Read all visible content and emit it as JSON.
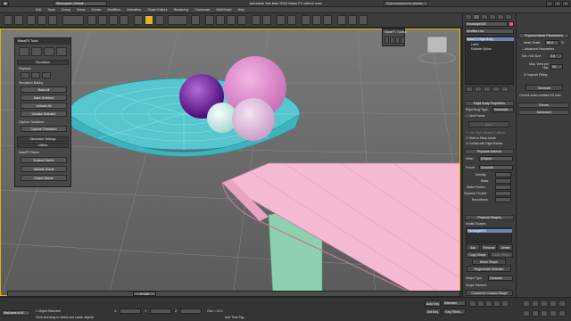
{
  "app": {
    "title": "Autodesk 3ds Max 2015   Mass FX video2.max",
    "workspace": "Workspace: Default",
    "search_placeholder": "Type a keyword or phrase"
  },
  "menu": [
    "Edit",
    "Tools",
    "Group",
    "Views",
    "Create",
    "Modifiers",
    "Animation",
    "Graph Editors",
    "Rendering",
    "Customize",
    "MAXScript",
    "Help"
  ],
  "viewport": {
    "label": "[+] [Camera001] [Realistic + Edged Faces]"
  },
  "massfx_tools": {
    "title": "MassFX Tools",
    "section_simulation": "Simulation",
    "playback": "Playback",
    "simulation_baking": "Simulation Baking",
    "bake_all": "Bake All",
    "bake_selected": "Bake Selected",
    "unbake_all": "Unbake All",
    "unbake_selected": "Unbake Selected",
    "capture_transform_hdr": "Capture Transform",
    "capture_transform": "Capture Transform",
    "simulation_settings": "Simulation Settings",
    "utilities": "Utilities",
    "massfx_scene": "MassFX Scene",
    "explore_scene": "Explore Scene",
    "validate_scene": "Validate Scene",
    "export_scene": "Export Scene"
  },
  "massfx_toolbar": {
    "title": "MassFX Toolbar"
  },
  "command_panel": {
    "object_name": "Rectangle003",
    "modifier_list": "Modifier List",
    "stack": [
      "MassFX Rigid Body",
      "Lathe",
      "Editable Spline"
    ],
    "rigid_props_hdr": "Rigid Body Properties",
    "rigid_body_type_label": "Rigid Body Type:",
    "rigid_body_type": "Kinematic",
    "until_frame": "Until Frame",
    "bake": "Bake",
    "use_high_velocity": "Use High Velocity Collision",
    "start_in_sleep": "Start in Sleep Mode",
    "collide_rigid": "Collide with Rigid Bodies",
    "phys_material_hdr": "Physical Material",
    "mesh_label": "Mesh:",
    "mesh_value": "(Object)",
    "preset_label": "Preset:",
    "preset_value": "Concrete",
    "density": "Density:",
    "mass": "Mass:",
    "static_friction": "Static Friction:",
    "dynamic_friction": "Dynamic Friction:",
    "bounciness": "Bounciness:",
    "phys_shapes_hdr": "Physical Shapes",
    "modify_shapes": "Modify Shapes",
    "shape_item": "Rectangle003",
    "add": "Add",
    "rename": "Rename",
    "delete": "Delete",
    "copy_shape": "Copy Shape",
    "paste_shape": "Paste Shape",
    "mirror_shape": "Mirror Shape",
    "regenerate_selected": "Regenerate Selected",
    "shape_type_label": "Shape Type:",
    "shape_type": "Concave",
    "shape_element": "Shape Element:",
    "convert_custom": "Convert to Custom Shape",
    "override_material": "Override Physical Material",
    "display_shaded": "Display Shaded Hulls"
  },
  "physical_mesh": {
    "hdr": "Physical Mesh Parameters",
    "mesh_detail_label": "Mesh Detail:",
    "mesh_detail": "80.0",
    "advanced": "Advanced Parameters",
    "min_hull_size_label": "Min. Hull Size:",
    "min_hull_size": "0.0",
    "max_verts_label": "Max. Verts per Hull:",
    "max_verts": "24",
    "improve_fitting": "Improve Fitting",
    "generate": "Generate",
    "status": "Current mesh contains 33 hulls",
    "forces": "Forces",
    "advanced_roll": "Advanced"
  },
  "time": {
    "frame": "0 / 100"
  },
  "status": {
    "selected": "1 Object Selected",
    "hint": "Click and drag to select and rotate objects",
    "x_label": "X:",
    "y_label": "Y:",
    "z_label": "Z:",
    "grid": "Grid = 10.0",
    "auto_key": "Auto Key",
    "selected_btn": "Selected",
    "set_key": "Set Key",
    "key_filters": "Key Filters...",
    "add_time_tag": "Add Time Tag",
    "welcome": "Welcome to M"
  }
}
